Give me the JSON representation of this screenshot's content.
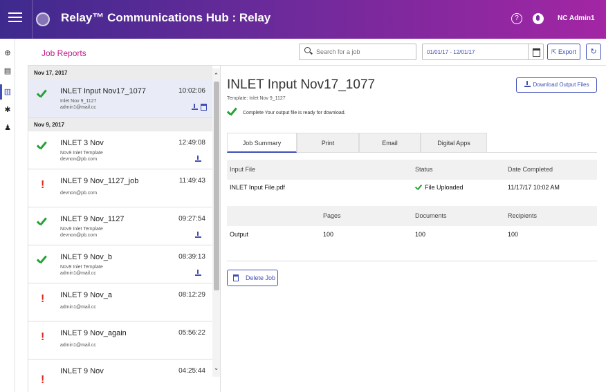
{
  "header": {
    "title": "Relay™ Communications Hub : Relay",
    "help_glyph": "?",
    "user": "NC Admin1"
  },
  "toolbar": {
    "breadcrumb": "Job Reports",
    "search_placeholder": "Search for a job",
    "date_range": "01/01/17 - 12/01/17",
    "export_label": "Export",
    "refresh_glyph": "↻"
  },
  "jobs": {
    "groups": [
      {
        "date": "Nov 17, 2017",
        "items": [
          {
            "name": "INLET Input Nov17_1077",
            "template": "Inlet Nov 9_1127",
            "email": "admin1@mail.cc",
            "time": "10:02:06",
            "status": "complete",
            "selected": true
          }
        ]
      },
      {
        "date": "Nov 9, 2017",
        "items": [
          {
            "name": "INLET 3 Nov",
            "template": "Nov9 Inlet Template",
            "email": "devnon@pb.com",
            "time": "12:49:08",
            "status": "complete"
          },
          {
            "name": "INLET 9 Nov_1127_job",
            "template": "",
            "email": "devnon@pb.com",
            "time": "11:49:43",
            "status": "error"
          },
          {
            "name": "INLET 9 Nov_1127",
            "template": "Nov9 Inlet Template",
            "email": "devnon@pb.com",
            "time": "09:27:54",
            "status": "complete"
          },
          {
            "name": "INLET 9 Nov_b",
            "template": "Nov9 Inlet Template",
            "email": "admin1@mail.cc",
            "time": "08:39:13",
            "status": "complete"
          },
          {
            "name": "INLET 9 Nov_a",
            "template": "",
            "email": "admin1@mail.cc",
            "time": "08:12:29",
            "status": "error"
          },
          {
            "name": "INLET 9 Nov_again",
            "template": "",
            "email": "admin1@mail.cc",
            "time": "05:56:22",
            "status": "error"
          },
          {
            "name": "INLET 9 Nov",
            "template": "",
            "email": "",
            "time": "04:25:44",
            "status": "error"
          }
        ]
      }
    ]
  },
  "detail": {
    "title": "INLET Input Nov17_1077",
    "template": "Template: Inlet Nov 9_1127",
    "status_text": "Complete   Your output file is ready for download.",
    "download_label": "Download Output Files",
    "tabs": [
      "Job Summary",
      "Print",
      "Email",
      "Digital Apps"
    ],
    "input_table": {
      "headers": [
        "Input File",
        "Status",
        "Date Completed"
      ],
      "row": {
        "file": "INLET Input File.pdf",
        "status": "File Uploaded",
        "date": "11/17/17 10:02 AM"
      }
    },
    "output_table": {
      "headers": [
        "",
        "Pages",
        "Documents",
        "Recipients"
      ],
      "row": {
        "label": "Output",
        "pages": "100",
        "documents": "100",
        "recipients": "100"
      }
    },
    "delete_label": "Delete Job"
  }
}
